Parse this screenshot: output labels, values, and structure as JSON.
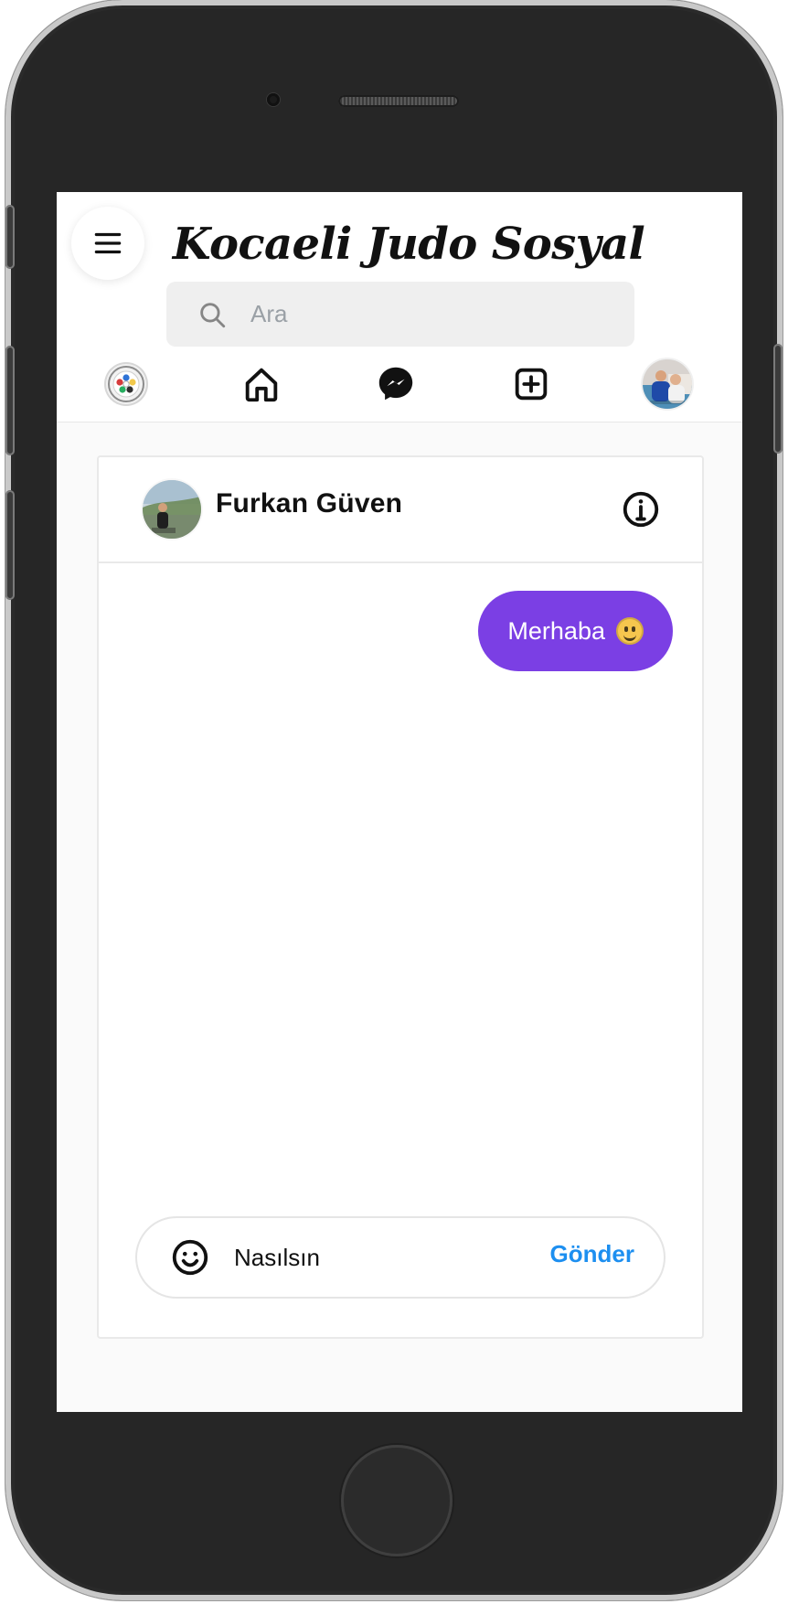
{
  "app": {
    "brand_title": "Kocaeli Judo Sosyal"
  },
  "search": {
    "placeholder": "Ara"
  },
  "navbar": {
    "items": [
      {
        "name": "judo-logo",
        "icon": "judo-logo"
      },
      {
        "name": "home",
        "icon": "home-icon"
      },
      {
        "name": "messenger",
        "icon": "messenger-icon"
      },
      {
        "name": "add",
        "icon": "add-icon"
      },
      {
        "name": "profile",
        "icon": "avatar"
      }
    ]
  },
  "chat": {
    "recipient_name": "Furkan Güven",
    "messages": [
      {
        "from": "me",
        "text": "Merhaba",
        "emoji": "slightly-smiling-face"
      }
    ],
    "composer_value": "Nasılsın",
    "send_label": "Gönder"
  },
  "colors": {
    "bubble": "#7b3fe4",
    "send": "#1d8ff0",
    "frame": "#2a2a2a"
  }
}
